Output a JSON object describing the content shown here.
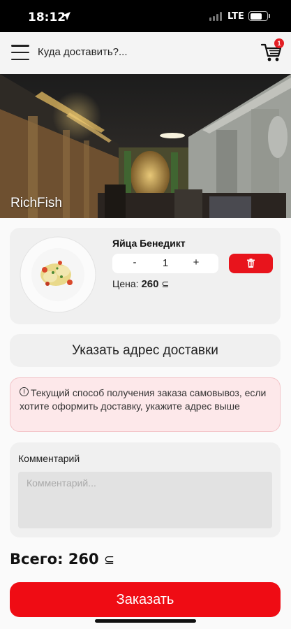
{
  "status_bar": {
    "time": "18:12",
    "network": "LTE",
    "battery_level": 0.7
  },
  "header": {
    "address_placeholder": "Куда доставить?...",
    "cart_count": "1"
  },
  "restaurant": {
    "name": "RichFish"
  },
  "cart_item": {
    "name": "Яйца Бенедикт",
    "quantity": "1",
    "minus_label": "-",
    "plus_label": "+",
    "price_label": "Цена:",
    "price_value": "260",
    "currency": "⊆"
  },
  "address_button": {
    "label": "Указать адрес доставки"
  },
  "notice": {
    "text": "Текущий способ получения заказа самовывоз, если хотите оформить доставку, укажите адрес выше"
  },
  "comment": {
    "label": "Комментарий",
    "placeholder": "Комментарий..."
  },
  "total": {
    "label": "Всего:",
    "value": "260",
    "currency": "⊆"
  },
  "order_button": {
    "label": "Заказать"
  },
  "colors": {
    "accent_red": "#ef0c14",
    "badge_red": "#e31e24",
    "notice_bg": "#fde8ea"
  },
  "icons": [
    "location-arrow-icon",
    "signal-icon",
    "battery-icon",
    "hamburger-menu-icon",
    "cart-icon",
    "trash-icon",
    "info-icon"
  ]
}
